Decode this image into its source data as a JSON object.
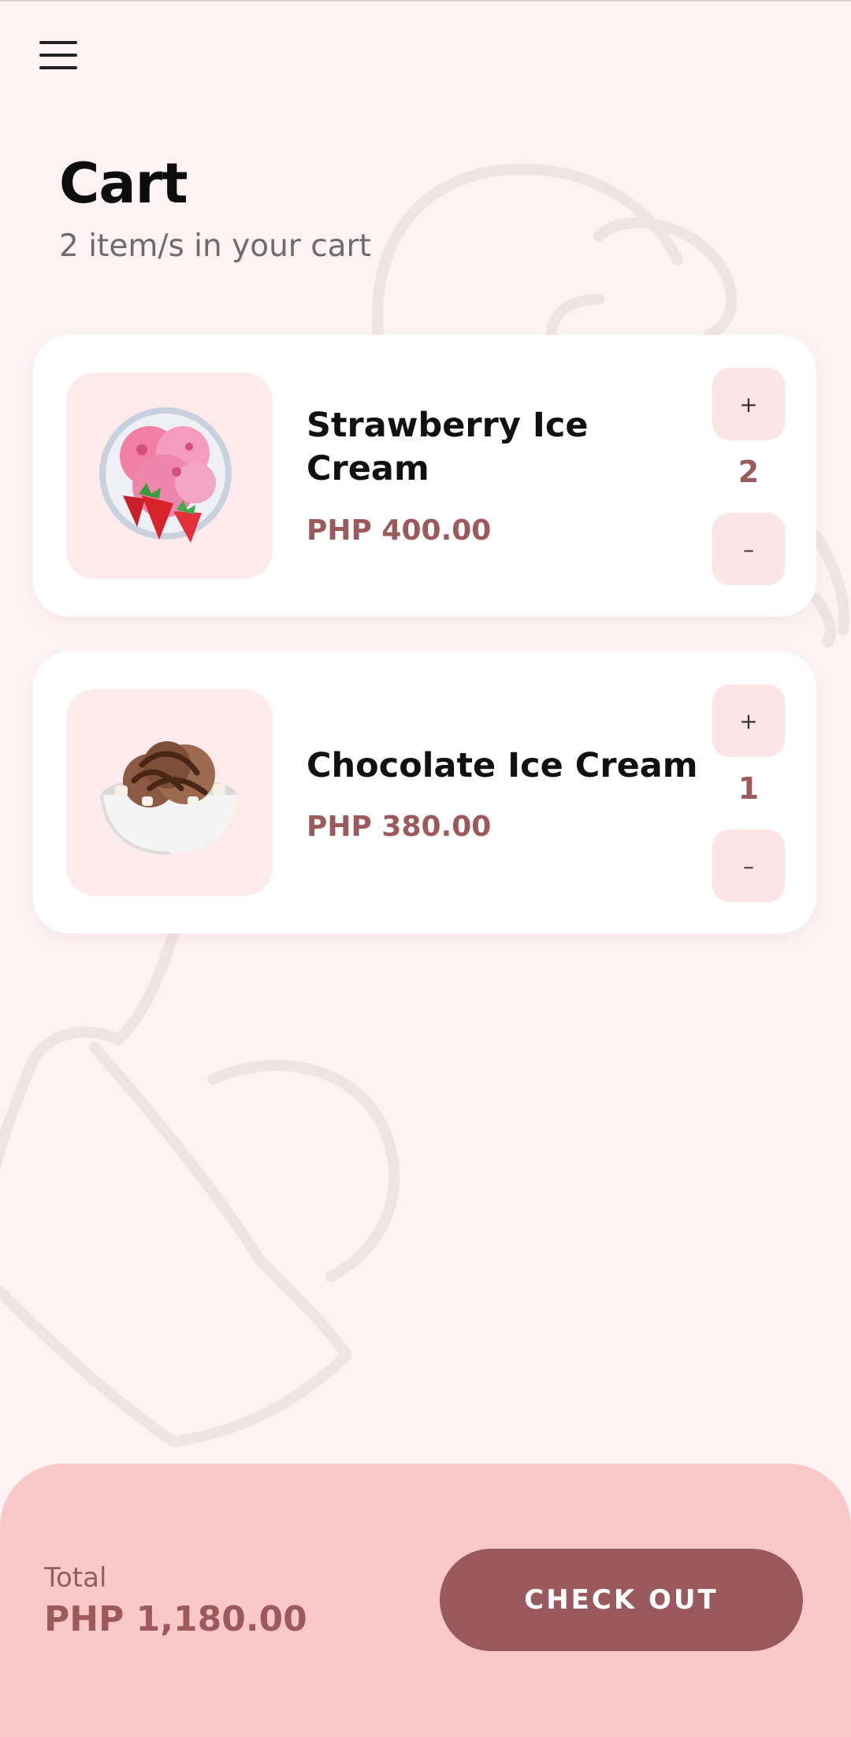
{
  "header": {
    "menu_icon": "hamburger-menu-icon"
  },
  "page": {
    "title": "Cart",
    "subtitle": "2 item/s in your cart"
  },
  "items": [
    {
      "name": "Strawberry Ice Cream",
      "price": "PHP 400.00",
      "quantity": "2",
      "image": "strawberry-ice-cream-image",
      "plus_label": "+",
      "minus_label": "–"
    },
    {
      "name": "Chocolate Ice Cream",
      "price": "PHP 380.00",
      "quantity": "1",
      "image": "chocolate-ice-cream-image",
      "plus_label": "+",
      "minus_label": "–"
    }
  ],
  "footer": {
    "total_label": "Total",
    "total_value": "PHP 1,180.00",
    "checkout_label": "CHECK OUT"
  },
  "colors": {
    "background": "#fdf3f4",
    "accent": "#9a5a5d",
    "footer": "#fbc8ca",
    "qty_button": "#fde4e6"
  }
}
